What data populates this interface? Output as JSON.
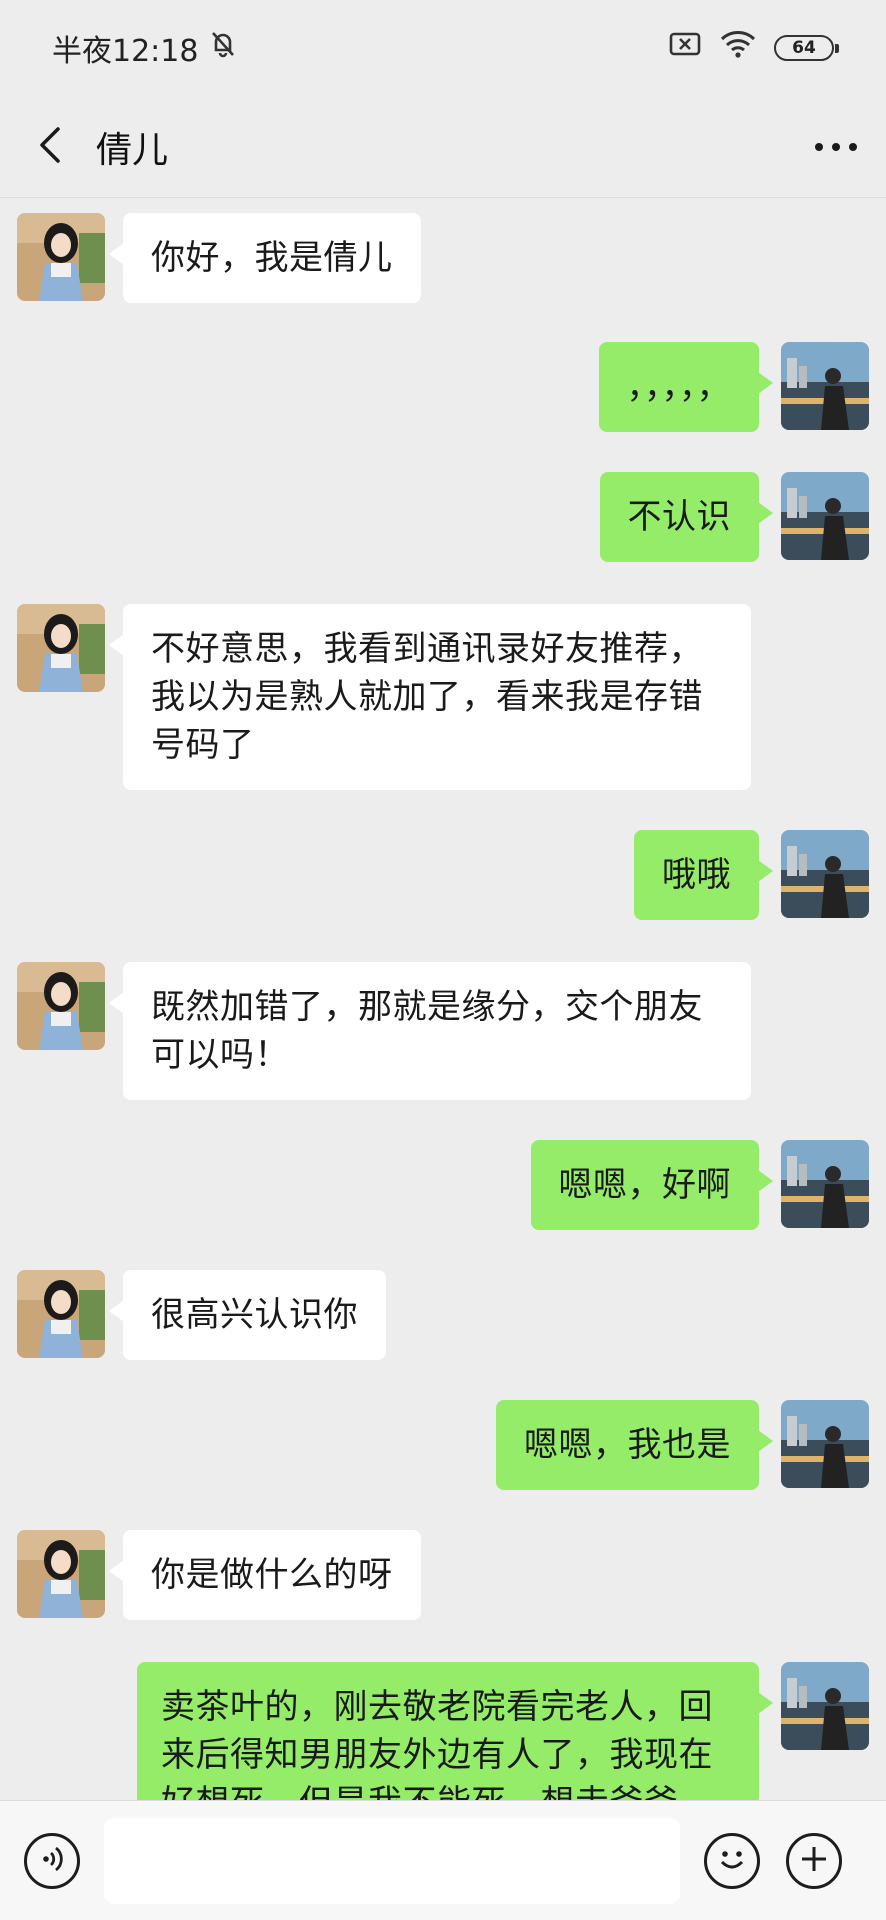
{
  "status_bar": {
    "time": "半夜12:18",
    "battery": "64",
    "icons": [
      "mute-bell-icon",
      "sim-off-icon",
      "wifi-icon",
      "battery-icon"
    ]
  },
  "header": {
    "title": "倩儿",
    "back_icon": "chevron-left-icon",
    "more_icon": "more-dots-icon"
  },
  "messages": [
    {
      "side": "left",
      "text": "你好，我是倩儿"
    },
    {
      "side": "right",
      "text": "，，，，，"
    },
    {
      "side": "right",
      "text": "不认识"
    },
    {
      "side": "left",
      "text": "不好意思，我看到通讯录好友推荐，我以为是熟人就加了，看来我是存错号码了"
    },
    {
      "side": "right",
      "text": "哦哦"
    },
    {
      "side": "left",
      "text": "既然加错了，那就是缘分，交个朋友可以吗！"
    },
    {
      "side": "right",
      "text": "嗯嗯，好啊"
    },
    {
      "side": "left",
      "text": "很高兴认识你"
    },
    {
      "side": "right",
      "text": "嗯嗯，我也是"
    },
    {
      "side": "left",
      "text": "你是做什么的呀"
    },
    {
      "side": "right",
      "text": "卖茶叶的，刚去敬老院看完老人，回来后得知男朋友外边有人了，我现在好想死，但是我不能死，想走爸爸"
    }
  ],
  "input_bar": {
    "voice_icon": "voice-icon",
    "emoji_icon": "emoji-icon",
    "plus_icon": "plus-icon",
    "input_value": ""
  },
  "colors": {
    "background": "#ededed",
    "bubble_self": "#95ec69",
    "bubble_other": "#ffffff"
  }
}
